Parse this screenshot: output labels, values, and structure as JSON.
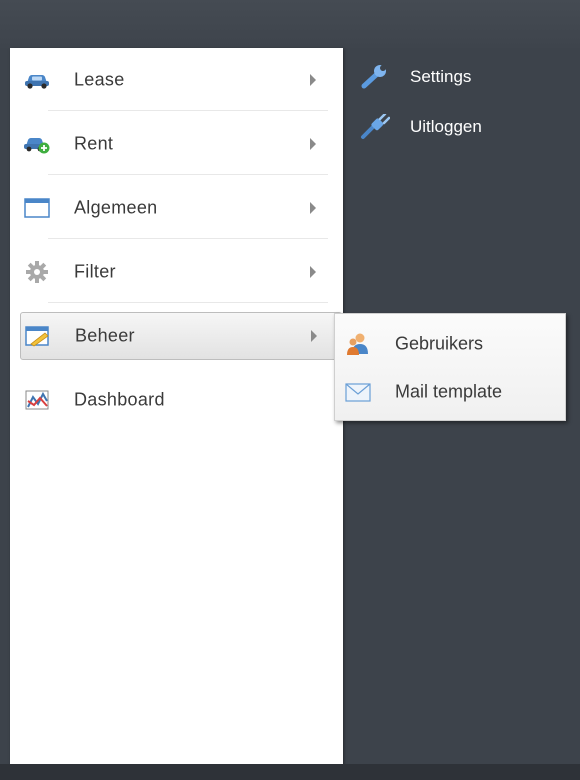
{
  "main_menu": {
    "items": [
      {
        "label": "Lease",
        "icon": "car-icon"
      },
      {
        "label": "Rent",
        "icon": "car-plus-icon"
      },
      {
        "label": "Algemeen",
        "icon": "window-icon"
      },
      {
        "label": "Filter",
        "icon": "gear-icon"
      },
      {
        "label": "Beheer",
        "icon": "edit-window-icon"
      },
      {
        "label": "Dashboard",
        "icon": "chart-icon"
      }
    ],
    "active_item": "Beheer"
  },
  "submenu": {
    "items": [
      {
        "label": "Gebruikers",
        "icon": "users-icon"
      },
      {
        "label": "Mail template",
        "icon": "mail-icon"
      }
    ]
  },
  "top_links": [
    {
      "label": "Settings",
      "icon": "wrench-icon"
    },
    {
      "label": "Uitloggen",
      "icon": "logout-plug-icon"
    }
  ],
  "colors": {
    "background": "#3d434b",
    "menu_background": "#ffffff",
    "text": "#3a3a3a",
    "link_text": "#ffffff",
    "icon_blue": "#4a86c8"
  }
}
